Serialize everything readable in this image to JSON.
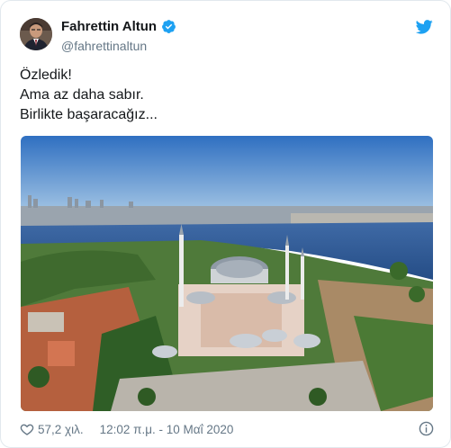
{
  "author": {
    "name": "Fahrettin Altun",
    "handle": "@fahrettinaltun"
  },
  "tweet": {
    "lines": [
      "Özledik!",
      "Ama az daha sabır.",
      "Birlikte başaracağız..."
    ]
  },
  "footer": {
    "likes": "57,2 χιλ.",
    "timestamp": "12:02 π.μ. - 10 Μαΐ 2020"
  },
  "colors": {
    "brand": "#1da1f2",
    "muted": "#657786",
    "text": "#14171a"
  },
  "icons": [
    "verified-icon",
    "twitter-bird-icon",
    "heart-icon",
    "info-icon"
  ]
}
